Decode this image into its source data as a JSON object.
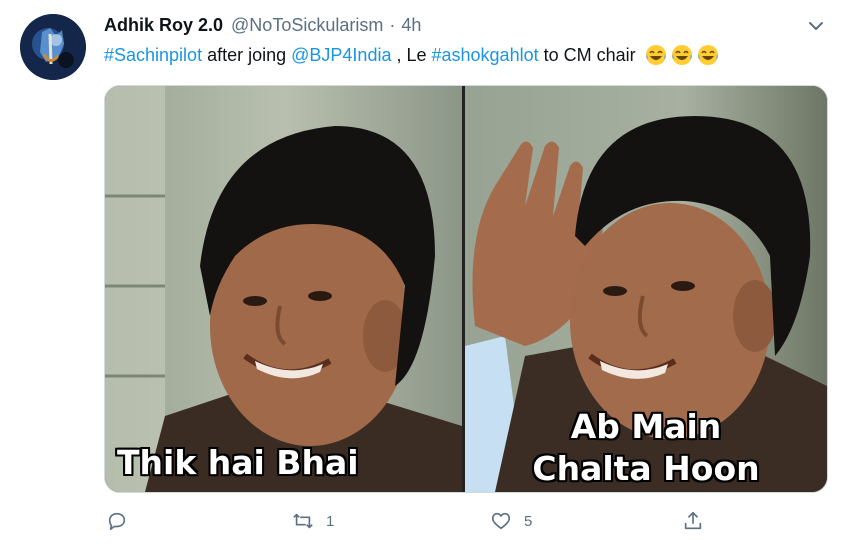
{
  "author": {
    "display_name": "Adhik Roy 2.0",
    "handle": "@NoToSickularism",
    "separator": "·",
    "time": "4h"
  },
  "tweet": {
    "segments": [
      {
        "text": "#Sachinpilot",
        "type": "link"
      },
      {
        "text": " after joing ",
        "type": "text"
      },
      {
        "text": "@BJP4India",
        "type": "link"
      },
      {
        "text": " , Le ",
        "type": "text"
      },
      {
        "text": "#ashokgahlot",
        "type": "link"
      },
      {
        "text": " to CM chair ",
        "type": "text"
      }
    ],
    "emojis": [
      "laughing-tears-emoji",
      "laughing-tears-emoji",
      "laughing-tears-emoji"
    ]
  },
  "media": {
    "left_caption": "Thik hai Bhai",
    "right_caption_line1": "Ab Main",
    "right_caption_line2": "Chalta Hoon"
  },
  "actions": {
    "reply_icon": "reply-icon",
    "retweet_icon": "retweet-icon",
    "retweet_count": "1",
    "like_icon": "heart-icon",
    "like_count": "5",
    "share_icon": "share-icon"
  },
  "colors": {
    "link": "#1b95e0",
    "secondary": "#5b7083",
    "text": "#0f1419"
  }
}
